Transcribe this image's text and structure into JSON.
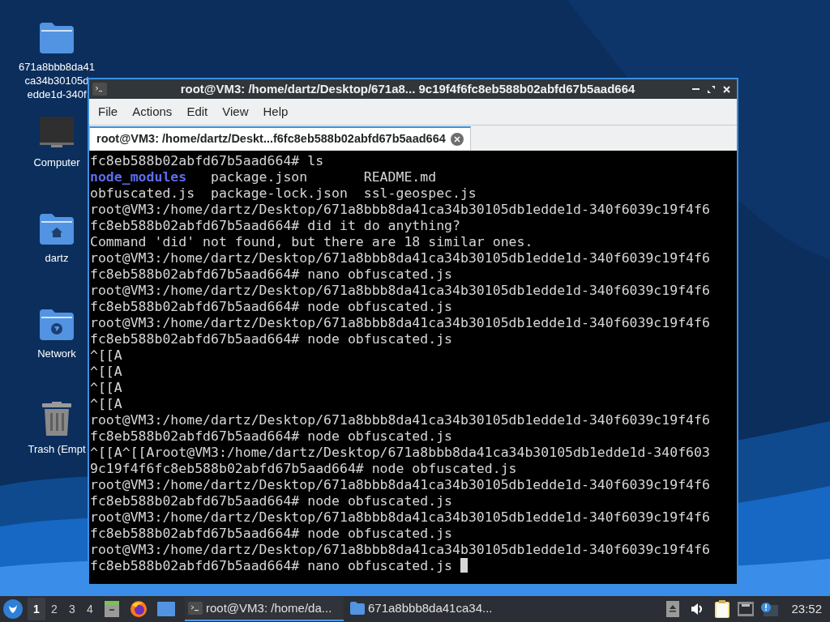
{
  "desktop_icons": [
    {
      "kind": "folder",
      "label_lines": [
        "671a8bbb8da41",
        "ca34b30105d",
        "edde1d-340f"
      ]
    },
    {
      "kind": "computer",
      "label_lines": [
        "Computer"
      ]
    },
    {
      "kind": "home",
      "label_lines": [
        "dartz"
      ]
    },
    {
      "kind": "network",
      "label_lines": [
        "Network"
      ]
    },
    {
      "kind": "trash",
      "label_lines": [
        "Trash (Empt"
      ]
    }
  ],
  "window": {
    "title": "root@VM3: /home/dartz/Desktop/671a8... 9c19f4f6fc8eb588b02abfd67b5aad664",
    "menu": [
      "File",
      "Actions",
      "Edit",
      "View",
      "Help"
    ],
    "tabs": [
      {
        "label": "root@VM3: /home/dartz/Deskt...f6fc8eb588b02abfd67b5aad664",
        "selected": true
      }
    ],
    "terminal": {
      "cursor_visible": true,
      "lines": [
        {
          "kind": "text",
          "text": "fc8eb588b02abfd67b5aad664# ls"
        },
        {
          "kind": "listing",
          "entries": [
            {
              "name": "node_modules",
              "kind": "directory"
            },
            {
              "name": "package.json",
              "kind": "file"
            },
            {
              "name": "README.md",
              "kind": "file"
            }
          ]
        },
        {
          "kind": "listing",
          "entries": [
            {
              "name": "obfuscated.js",
              "kind": "file"
            },
            {
              "name": "package-lock.json",
              "kind": "file"
            },
            {
              "name": "ssl-geospec.js",
              "kind": "file"
            }
          ]
        },
        {
          "kind": "text",
          "text": "root@VM3:/home/dartz/Desktop/671a8bbb8da41ca34b30105db1edde1d-340f6039c19f4f6"
        },
        {
          "kind": "text",
          "text": "fc8eb588b02abfd67b5aad664# did it do anything?"
        },
        {
          "kind": "text",
          "text": "Command 'did' not found, but there are 18 similar ones."
        },
        {
          "kind": "text",
          "text": "root@VM3:/home/dartz/Desktop/671a8bbb8da41ca34b30105db1edde1d-340f6039c19f4f6"
        },
        {
          "kind": "text",
          "text": "fc8eb588b02abfd67b5aad664# nano obfuscated.js"
        },
        {
          "kind": "text",
          "text": "root@VM3:/home/dartz/Desktop/671a8bbb8da41ca34b30105db1edde1d-340f6039c19f4f6"
        },
        {
          "kind": "text",
          "text": "fc8eb588b02abfd67b5aad664# node obfuscated.js"
        },
        {
          "kind": "text",
          "text": "root@VM3:/home/dartz/Desktop/671a8bbb8da41ca34b30105db1edde1d-340f6039c19f4f6"
        },
        {
          "kind": "text",
          "text": "fc8eb588b02abfd67b5aad664# node obfuscated.js"
        },
        {
          "kind": "text",
          "text": "^[[A"
        },
        {
          "kind": "text",
          "text": "^[[A"
        },
        {
          "kind": "text",
          "text": "^[[A"
        },
        {
          "kind": "text",
          "text": "^[[A"
        },
        {
          "kind": "text",
          "text": "root@VM3:/home/dartz/Desktop/671a8bbb8da41ca34b30105db1edde1d-340f6039c19f4f6"
        },
        {
          "kind": "text",
          "text": "fc8eb588b02abfd67b5aad664# node obfuscated.js"
        },
        {
          "kind": "text",
          "text": "^[[A^[[Aroot@VM3:/home/dartz/Desktop/671a8bbb8da41ca34b30105db1edde1d-340f603"
        },
        {
          "kind": "text",
          "text": "9c19f4f6fc8eb588b02abfd67b5aad664# node obfuscated.js"
        },
        {
          "kind": "text",
          "text": "root@VM3:/home/dartz/Desktop/671a8bbb8da41ca34b30105db1edde1d-340f6039c19f4f6"
        },
        {
          "kind": "text",
          "text": "fc8eb588b02abfd67b5aad664# node obfuscated.js"
        },
        {
          "kind": "text",
          "text": "root@VM3:/home/dartz/Desktop/671a8bbb8da41ca34b30105db1edde1d-340f6039c19f4f6"
        },
        {
          "kind": "text",
          "text": "fc8eb588b02abfd67b5aad664# node obfuscated.js"
        },
        {
          "kind": "text",
          "text": "root@VM3:/home/dartz/Desktop/671a8bbb8da41ca34b30105db1edde1d-340f6039c19f4f6"
        },
        {
          "kind": "text",
          "text": "fc8eb588b02abfd67b5aad664# nano obfuscated.js "
        }
      ]
    }
  },
  "taskbar": {
    "workspaces": [
      {
        "label": "1",
        "selected": true
      },
      {
        "label": "2",
        "selected": false
      },
      {
        "label": "3",
        "selected": false
      },
      {
        "label": "4",
        "selected": false
      }
    ],
    "launchers": [
      {
        "kind": "cabinet"
      },
      {
        "kind": "browser"
      },
      {
        "kind": "desktop"
      }
    ],
    "tasks": [
      {
        "kind": "terminal",
        "label": "root@VM3: /home/da...",
        "selected": true
      },
      {
        "kind": "folder",
        "label": "671a8bbb8da41ca34...",
        "selected": false
      }
    ],
    "tray": [
      {
        "kind": "eject"
      },
      {
        "kind": "volume"
      },
      {
        "kind": "clipboard"
      },
      {
        "kind": "network"
      },
      {
        "kind": "notification"
      }
    ],
    "clock": "23:52"
  }
}
